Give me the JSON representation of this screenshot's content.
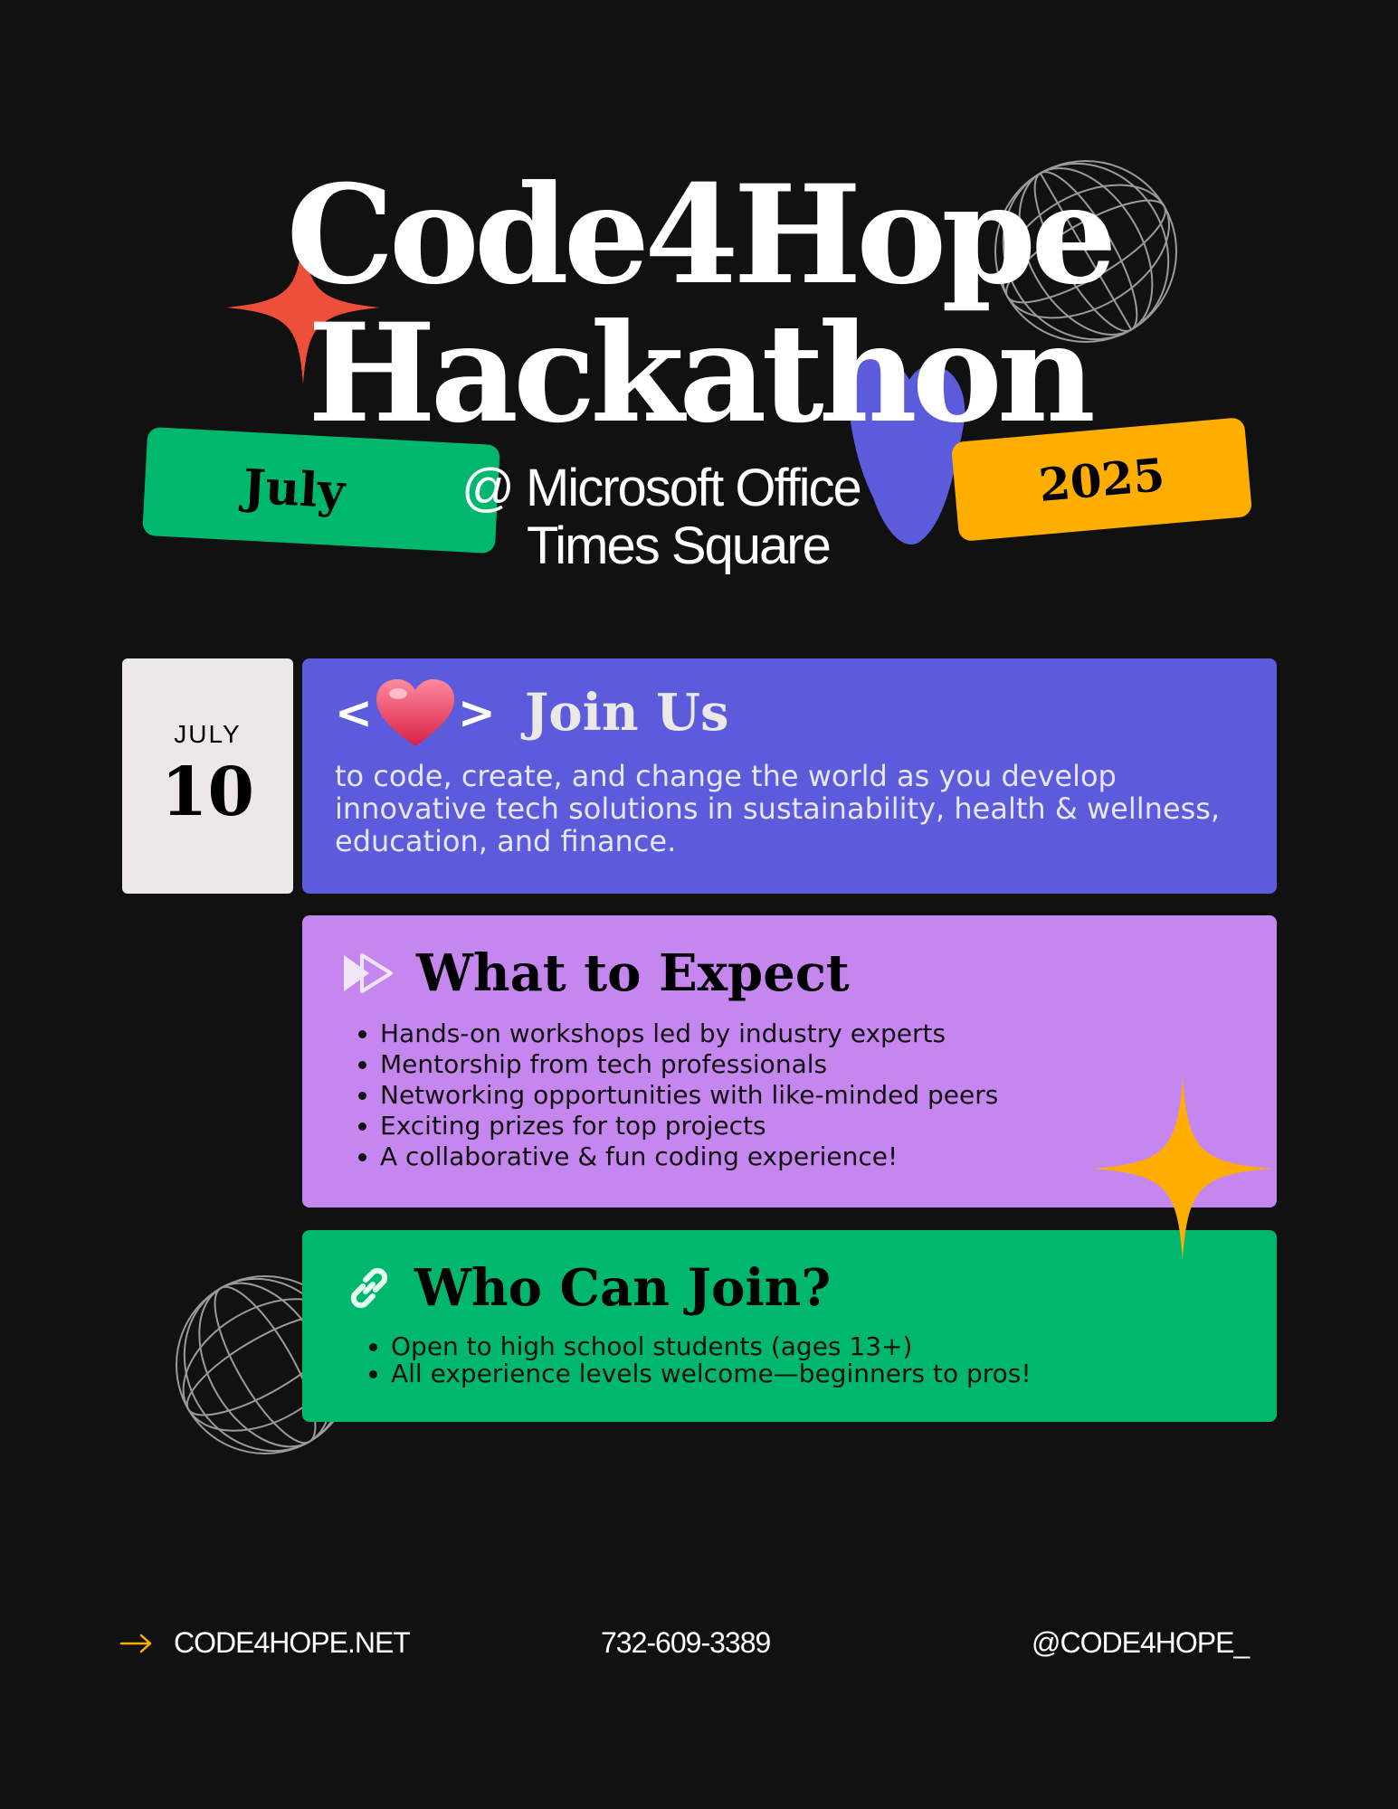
{
  "header": {
    "title_line1": "Code4Hope",
    "title_line2": "Hackathon",
    "month_tag": "July",
    "year_tag": "2025",
    "venue_line1": "@ Microsoft Office",
    "venue_line2": "Times Square"
  },
  "date_box": {
    "month": "JULY",
    "day": "10"
  },
  "join_card": {
    "open_bracket": "<",
    "close_bracket": ">",
    "heading": "Join Us",
    "body": "to code, create, and change the world as you develop innovative tech solutions in sustainability, health & wellness, education, and finance."
  },
  "expect_card": {
    "heading": "What to Expect",
    "items": [
      "Hands-on workshops led by industry experts",
      "Mentorship from tech professionals",
      "Networking opportunities with like-minded peers",
      "Exciting prizes for top projects",
      "A collaborative & fun coding experience!"
    ]
  },
  "who_card": {
    "heading": "Who Can Join?",
    "items": [
      "Open to high school students (ages 13+)",
      "All experience levels welcome—beginners to pros!"
    ]
  },
  "footer": {
    "website": "CODE4HOPE.NET",
    "phone": "732-609-3389",
    "handle": "@CODE4HOPE_"
  },
  "colors": {
    "background": "#111111",
    "indigo": "#5b5bdc",
    "lavender": "#c686f0",
    "green": "#00b76e",
    "amber": "#ffae00",
    "coral": "#ee4f3a",
    "date_box": "#ece8e7"
  },
  "icons": [
    "sparkle-icon",
    "wireframe-globe-icon",
    "heart-icon",
    "play-arrows-icon",
    "link-icon",
    "arrow-right-icon"
  ]
}
